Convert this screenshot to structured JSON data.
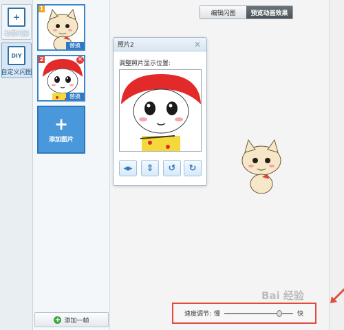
{
  "sidebar": {
    "items": [
      {
        "label": "动感闪图",
        "icon": "animated-frame-icon",
        "active": false
      },
      {
        "label": "自定义闪图",
        "icon": "diy-icon",
        "icon_text": "DIY",
        "active": true
      }
    ]
  },
  "frames": {
    "items": [
      {
        "number": "1",
        "replace_label": "替换",
        "has_delete": false
      },
      {
        "number": "2",
        "replace_label": "替换",
        "has_delete": true
      }
    ],
    "add_image_label": "添加图片",
    "add_frame_label": "添加一帧"
  },
  "tabs": [
    {
      "label": "编辑闪图",
      "active": false
    },
    {
      "label": "预览动画效果",
      "active": true
    }
  ],
  "photo_panel": {
    "title": "照片2",
    "hint": "调整照片显示位置:",
    "controls": [
      "flip-horizontal-icon",
      "flip-vertical-icon",
      "rotate-left-icon",
      "rotate-right-icon"
    ]
  },
  "speed": {
    "label": "速度调节:",
    "slow": "慢",
    "fast": "快",
    "value": 0.82
  },
  "watermark": "Bai 经验",
  "colors": {
    "accent": "#3b86c8",
    "highlight": "#e04b3c",
    "active_tab": "#4a5256"
  }
}
